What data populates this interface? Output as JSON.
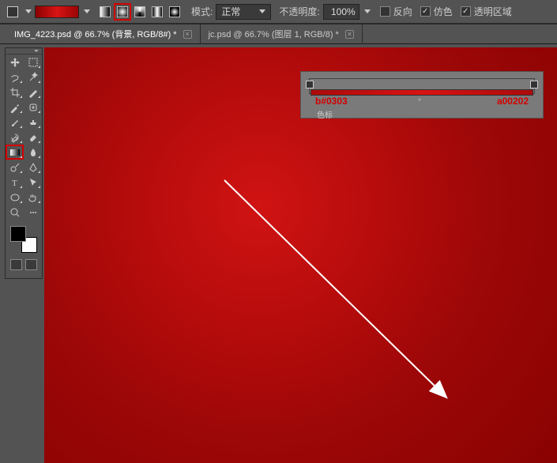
{
  "options": {
    "mode_label": "模式:",
    "mode_value": "正常",
    "opacity_label": "不透明度:",
    "opacity_value": "100%",
    "reverse_label": "反向",
    "reverse_checked": false,
    "dither_label": "仿色",
    "dither_checked": true,
    "transparency_label": "透明区域",
    "transparency_checked": true
  },
  "gradient_types": [
    "linear",
    "radial",
    "angular",
    "reflected",
    "diamond"
  ],
  "tabs": [
    {
      "label": "IMG_4223.psd @ 66.7% (背景, RGB/8#) *",
      "active": true
    },
    {
      "label": "jc.psd @ 66.7% (图层 1, RGB/8) *",
      "active": false
    }
  ],
  "toolbox": {
    "tools": [
      [
        "move",
        "marquee"
      ],
      [
        "lasso",
        "magic-wand"
      ],
      [
        "crop",
        "slice"
      ],
      [
        "eyedropper",
        "healing-brush"
      ],
      [
        "brush",
        "clone-stamp"
      ],
      [
        "history-brush",
        "eraser"
      ],
      [
        "gradient",
        "blur"
      ],
      [
        "dodge",
        "pen"
      ],
      [
        "type",
        "path-select"
      ],
      [
        "shape",
        "hand"
      ],
      [
        "zoom",
        "extra"
      ]
    ],
    "selected": "gradient"
  },
  "grad_editor": {
    "left_value": "b#0303",
    "right_value": "a00202",
    "mid": "°",
    "label": "色标"
  },
  "colors": {
    "fg": "#000000",
    "bg": "#ffffff"
  }
}
